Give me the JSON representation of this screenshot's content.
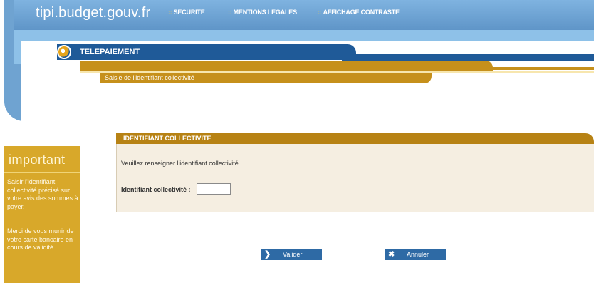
{
  "site": {
    "title": "tipi.budget.gouv.fr"
  },
  "nav": {
    "items": [
      {
        "label": "SECURITE"
      },
      {
        "label": "MENTIONS LEGALES"
      },
      {
        "label": "AFFICHAGE CONTRASTE"
      }
    ]
  },
  "banner": {
    "section": "TELEPAIEMENT",
    "breadcrumb": "Saisie de l'identifiant collectivité"
  },
  "sidebar": {
    "title": "important",
    "paragraphs": [
      "Saisir l'identifiant collectivité précisé sur votre avis des sommes à payer.",
      "Merci de vous munir de votre carte bancaire en cours de validité."
    ]
  },
  "form": {
    "header": "IDENTIFIANT COLLECTIVITE",
    "prompt": "Veuillez renseigner l'identifiant collectivité :",
    "field_label": "Identifiant collectivité :",
    "field_value": ""
  },
  "actions": {
    "validate_label": "Valider",
    "cancel_label": "Annuler"
  },
  "colors": {
    "header_blue": "#5f95c8",
    "dark_blue": "#1f5a98",
    "gold": "#c6901b",
    "panel_bg": "#f5eee1"
  }
}
